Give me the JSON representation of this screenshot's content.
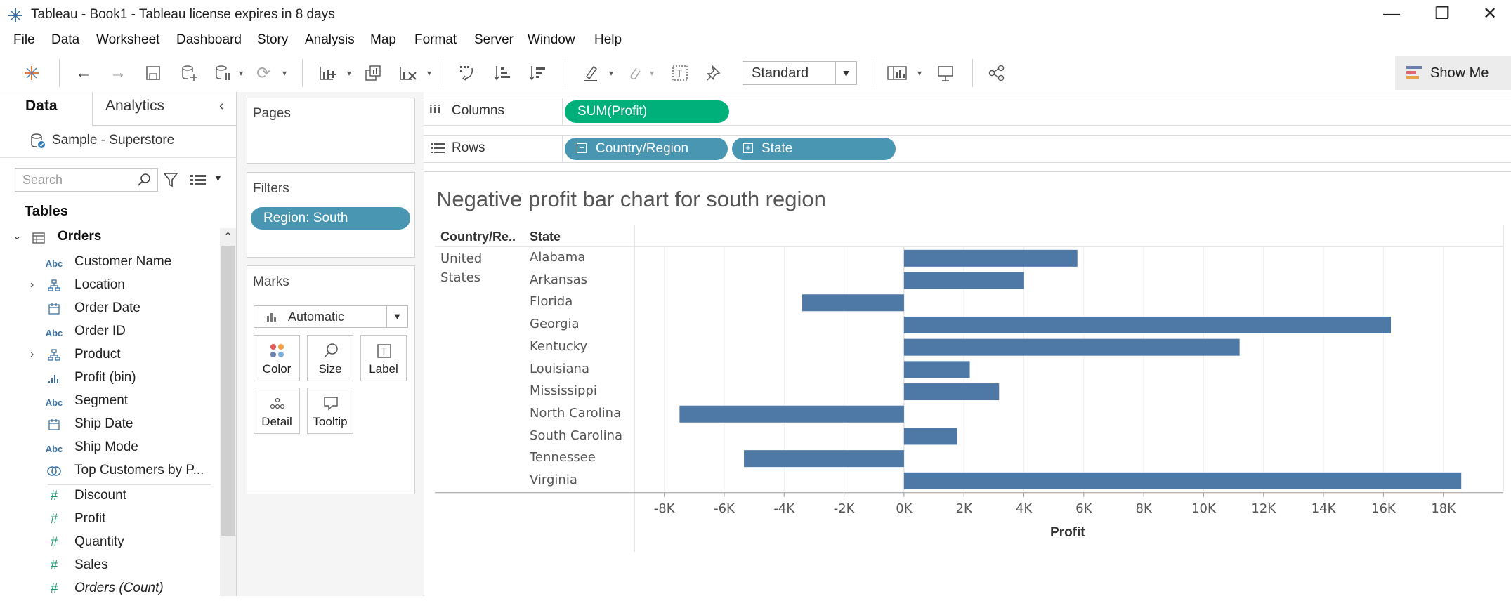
{
  "window": {
    "title": "Tableau - Book1 - Tableau license expires in 8 days",
    "controls": {
      "minimize": "—",
      "restore": "❐",
      "close": "✕"
    }
  },
  "menu": [
    "File",
    "Data",
    "Worksheet",
    "Dashboard",
    "Story",
    "Analysis",
    "Map",
    "Format",
    "Server",
    "Window",
    "Help"
  ],
  "toolbar": {
    "fit_select": "Standard",
    "show_me": "Show Me"
  },
  "left_pane": {
    "tabs": {
      "data": "Data",
      "analytics": "Analytics"
    },
    "datasource": "Sample - Superstore",
    "search_placeholder": "Search",
    "tables_label": "Tables",
    "table_name": "Orders",
    "fields": [
      {
        "icon": "Abc",
        "name": "Customer Name"
      },
      {
        "icon": "hierarchy",
        "name": "Location",
        "expandable": true
      },
      {
        "icon": "date",
        "name": "Order Date"
      },
      {
        "icon": "Abc",
        "name": "Order ID"
      },
      {
        "icon": "hierarchy",
        "name": "Product",
        "expandable": true
      },
      {
        "icon": "bin",
        "name": "Profit (bin)"
      },
      {
        "icon": "Abc",
        "name": "Segment"
      },
      {
        "icon": "date",
        "name": "Ship Date"
      },
      {
        "icon": "Abc",
        "name": "Ship Mode"
      },
      {
        "icon": "set",
        "name": "Top Customers by P..."
      },
      {
        "icon": "#",
        "name": "Discount"
      },
      {
        "icon": "#",
        "name": "Profit"
      },
      {
        "icon": "#",
        "name": "Quantity"
      },
      {
        "icon": "#",
        "name": "Sales"
      },
      {
        "icon": "#",
        "name": "Orders (Count)"
      }
    ]
  },
  "shelves": {
    "pages": "Pages",
    "filters": "Filters",
    "filter_pill": "Region: South",
    "marks": "Marks",
    "mark_type": "Automatic",
    "mark_buttons": [
      "Color",
      "Size",
      "Label",
      "Detail",
      "Tooltip"
    ],
    "columns_label": "Columns",
    "rows_label": "Rows",
    "columns_pill": "SUM(Profit)",
    "rows_pills": [
      "Country/Region",
      "State"
    ]
  },
  "colors": {
    "bar": "#4e79a7",
    "measure_pill": "#00b07a",
    "dimension_pill": "#4996b2"
  },
  "chart_data": {
    "type": "bar",
    "title": "Negative profit bar chart for south region",
    "row_headers": [
      "Country/Re..",
      "State"
    ],
    "country": "United States",
    "categories": [
      "Alabama",
      "Arkansas",
      "Florida",
      "Georgia",
      "Kentucky",
      "Louisiana",
      "Mississippi",
      "North Carolina",
      "South Carolina",
      "Tennessee",
      "Virginia"
    ],
    "values": [
      5787,
      4009,
      -3399,
      16250,
      11200,
      2196,
      3173,
      -7491,
      1769,
      -5342,
      18598
    ],
    "xlabel": "Profit",
    "xlim": [
      -9000,
      20000
    ],
    "xticks": [
      -8000,
      -6000,
      -4000,
      -2000,
      0,
      2000,
      4000,
      6000,
      8000,
      10000,
      12000,
      14000,
      16000,
      18000
    ],
    "xtick_labels": [
      "-8K",
      "-6K",
      "-4K",
      "-2K",
      "0K",
      "2K",
      "4K",
      "6K",
      "8K",
      "10K",
      "12K",
      "14K",
      "16K",
      "18K"
    ],
    "grid": true
  }
}
